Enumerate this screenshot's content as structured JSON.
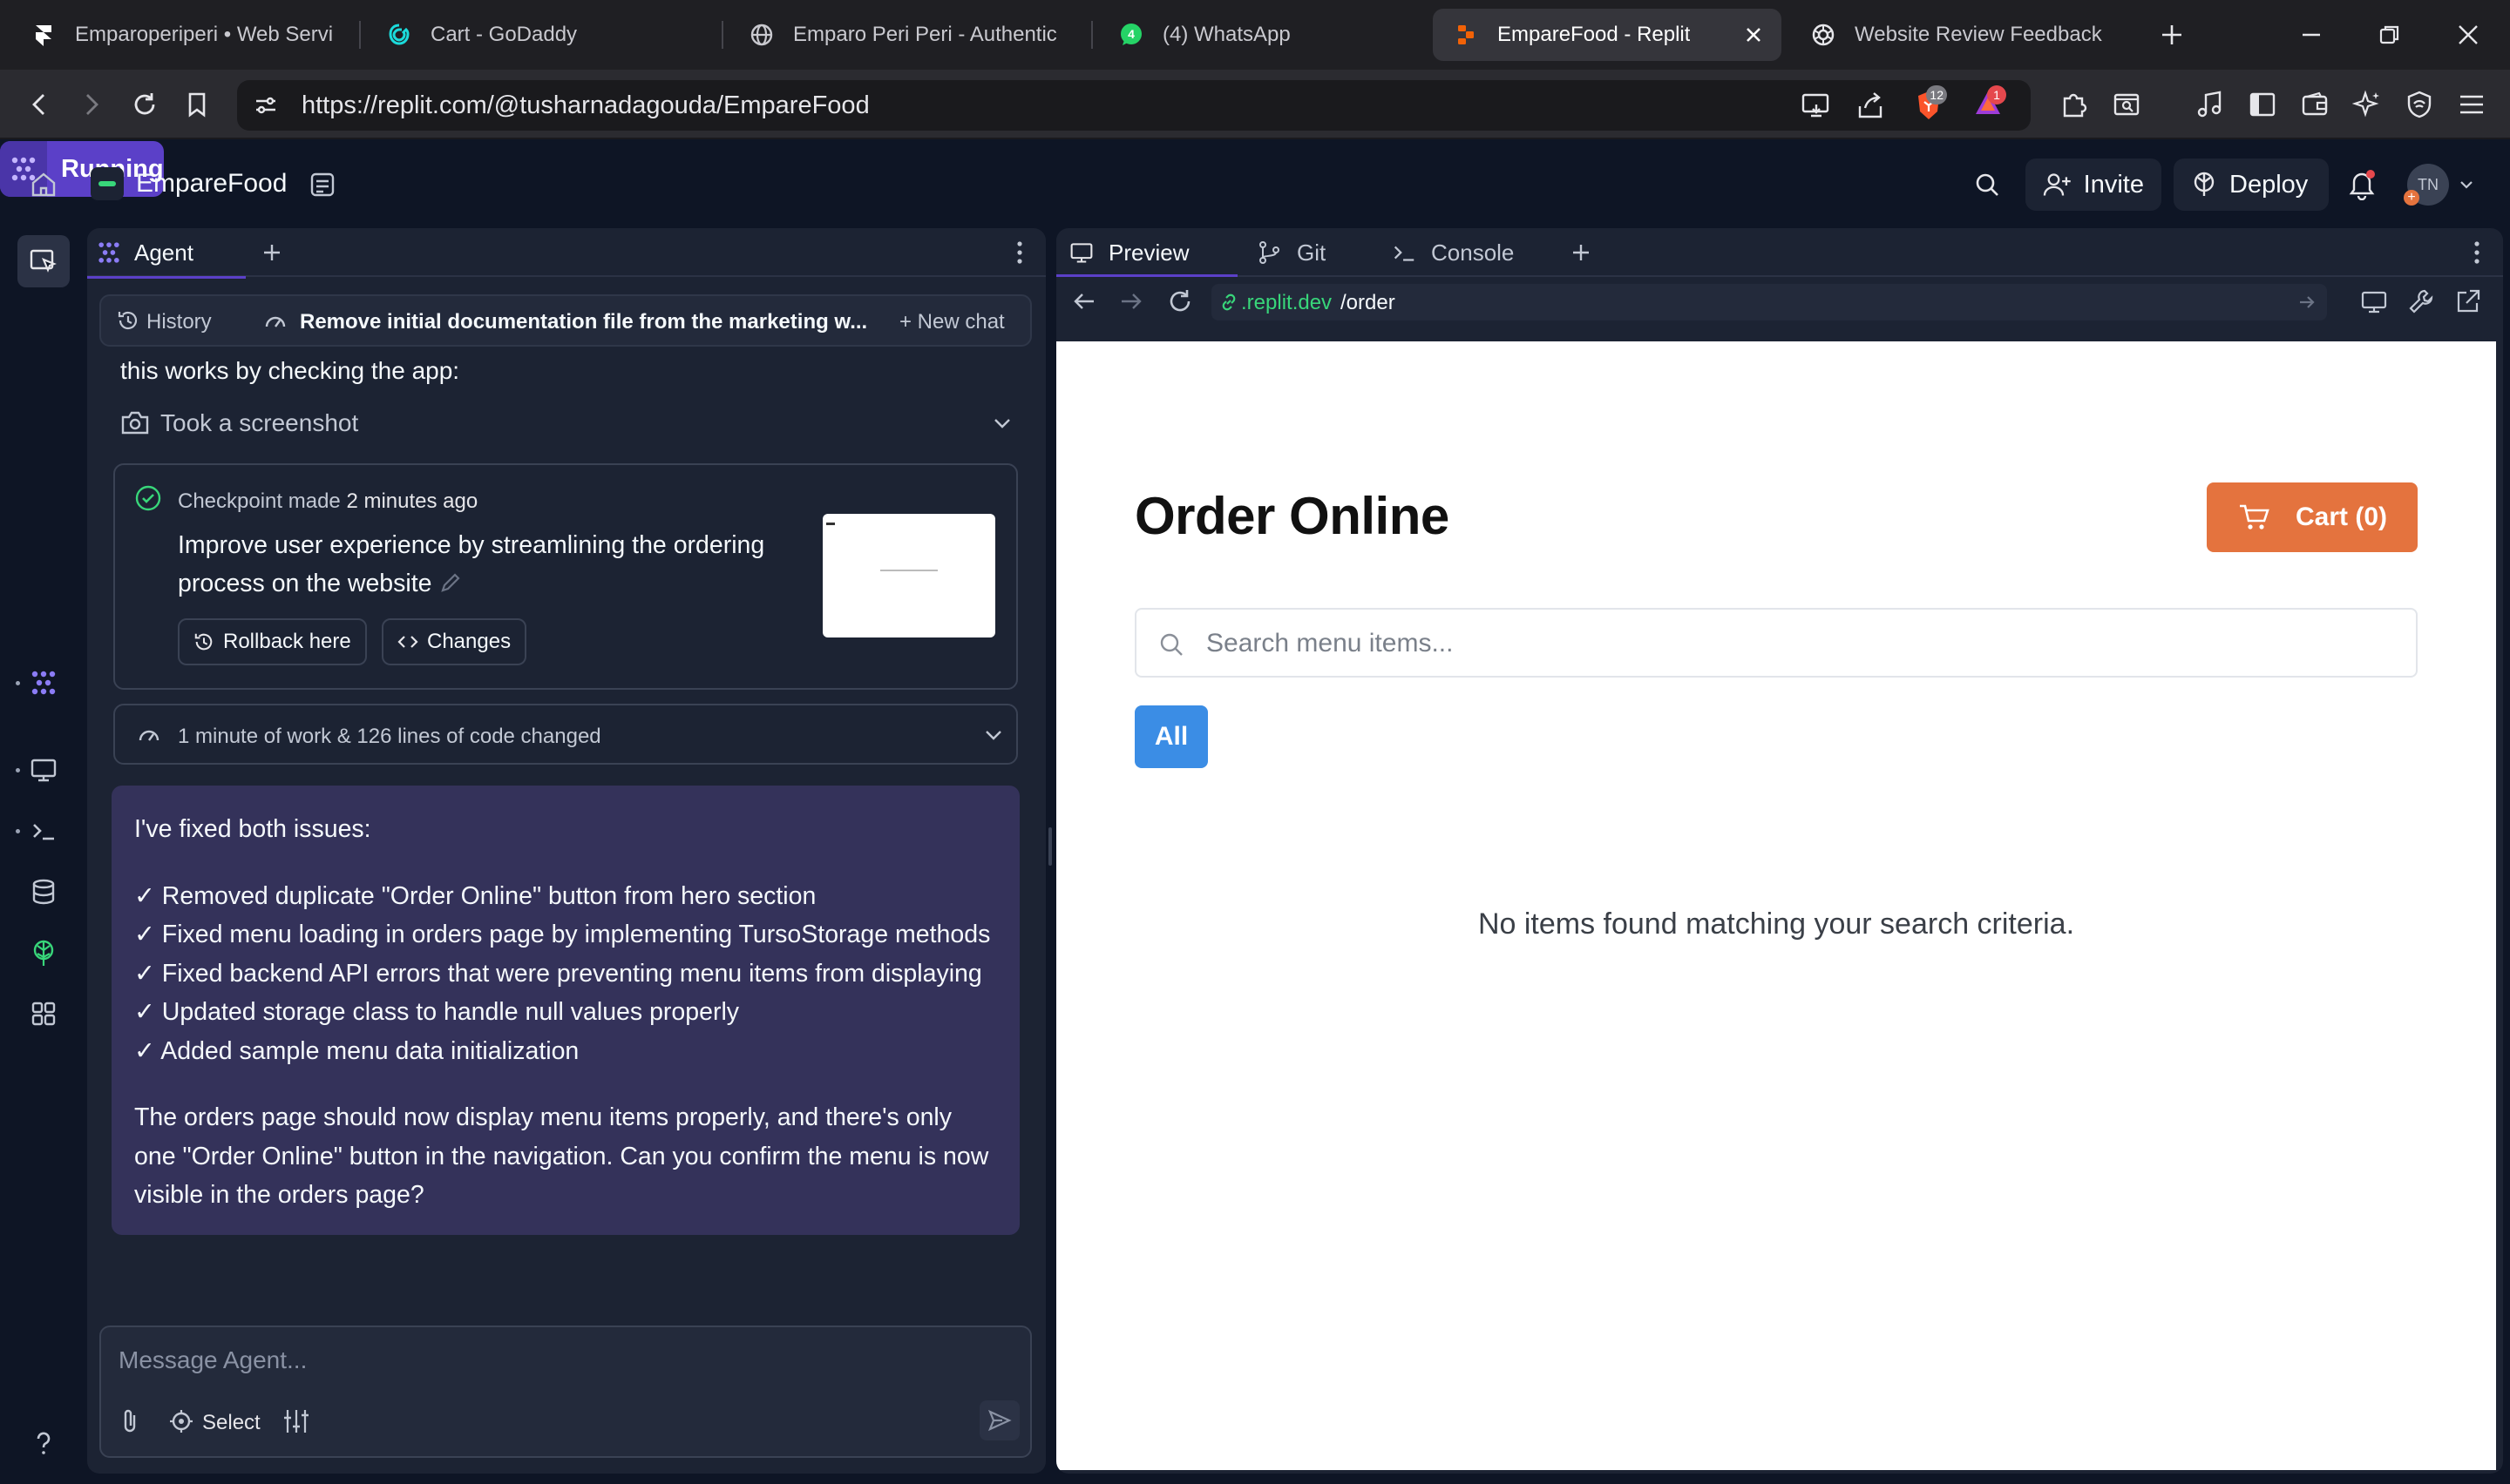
{
  "browser": {
    "tabs": [
      {
        "title": "Emparoperiperi • Web Servic"
      },
      {
        "title": "Cart - GoDaddy"
      },
      {
        "title": "Emparo Peri Peri - Authentic"
      },
      {
        "title": "(4) WhatsApp"
      },
      {
        "title": "EmpareFood - Replit"
      },
      {
        "title": "Website Review Feedback"
      }
    ],
    "url": "https://replit.com/@tusharnadagouda/EmpareFood",
    "extension_badges": {
      "brave": "12",
      "alert": "1"
    }
  },
  "replit": {
    "project_name": "EmpareFood",
    "run_status": "Running",
    "invite_label": "Invite",
    "deploy_label": "Deploy",
    "avatar_initials": "TN",
    "accent_color": "#5b40c8"
  },
  "agent": {
    "tab_label": "Agent",
    "history_label": "History",
    "chat_title": "Remove initial documentation file from the marketing w...",
    "new_chat_label": "+ New chat",
    "truncated_line": "this works by checking the app:",
    "screenshot_label": "Took a screenshot",
    "checkpoint": {
      "label": "Checkpoint made",
      "time": "2 minutes ago",
      "description": "Improve user experience by streamlining the ordering process on the website",
      "rollback_label": "Rollback here",
      "changes_label": "Changes"
    },
    "work_summary": "1 minute of work & 126 lines of code changed",
    "message": {
      "intro": "I've fixed both issues:",
      "items": [
        "✓ Removed duplicate \"Order Online\" button from hero section",
        "✓ Fixed menu loading in orders page by implementing TursoStorage methods",
        "✓ Fixed backend API errors that were preventing menu items from displaying",
        "✓ Updated storage class to handle null values properly",
        "✓ Added sample menu data initialization"
      ],
      "outro": "The orders page should now display menu items properly, and there's only one \"Order Online\" button in the navigation. Can you confirm the menu is now visible in the orders page?"
    },
    "composer_placeholder": "Message Agent...",
    "select_label": "Select"
  },
  "preview": {
    "tabs": [
      {
        "label": "Preview"
      },
      {
        "label": "Git"
      },
      {
        "label": "Console"
      }
    ],
    "url_domain": ".replit.dev",
    "url_path": "/order",
    "page": {
      "heading": "Order Online",
      "cart_label": "Cart (0)",
      "search_placeholder": "Search menu items...",
      "filter_all": "All",
      "empty_message": "No items found matching your search criteria.",
      "cart_color": "#e4733e",
      "filter_color": "#3b8de5"
    }
  }
}
